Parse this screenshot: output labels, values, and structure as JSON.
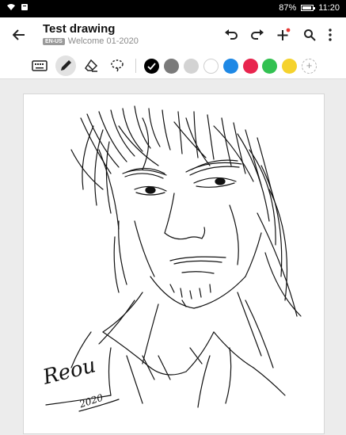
{
  "status": {
    "battery_percent": "87%",
    "time": "11:20"
  },
  "header": {
    "title": "Test drawing",
    "language_badge": "EN-US",
    "subtitle": "Welcome 01-2020"
  },
  "icons": {
    "back": "arrow-left-icon",
    "undo": "undo-icon",
    "redo": "redo-icon",
    "add": "plus-icon",
    "search": "search-icon",
    "more": "more-vertical-icon",
    "keyboard": "keyboard-icon",
    "pen": "pen-icon",
    "eraser": "eraser-icon",
    "lasso": "lasso-icon"
  },
  "palette": {
    "colors": [
      "#000000",
      "#7a7a7a",
      "#d3d3d3",
      "#ffffff",
      "#1e88e5",
      "#e8244d",
      "#32c151",
      "#f5d22d"
    ],
    "selected_index": 0,
    "accent_dot": "#e53935"
  },
  "drawing": {
    "signature_name": "Reou",
    "signature_year": "2020"
  }
}
